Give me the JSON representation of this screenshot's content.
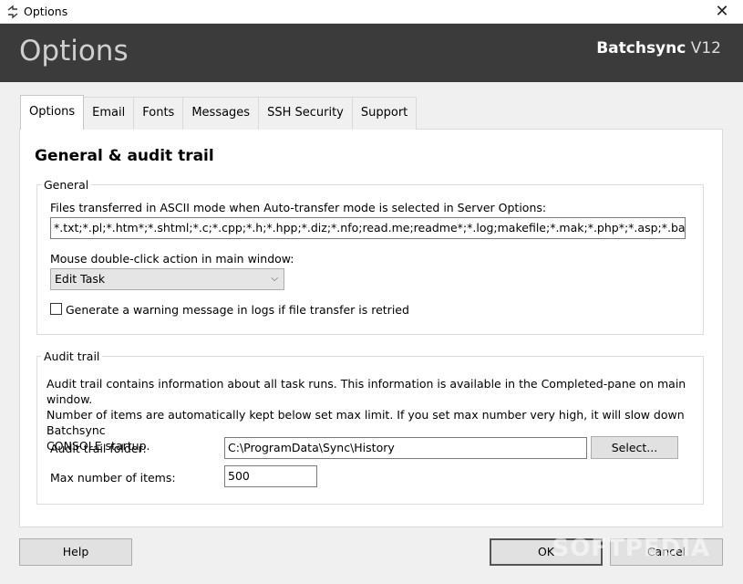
{
  "window": {
    "title": "Options",
    "close_glyph": "✕",
    "icon": "sync-app-icon"
  },
  "banner": {
    "title": "Options",
    "brand": "Batchsync",
    "version": "V12"
  },
  "tabs": [
    {
      "label": "Options"
    },
    {
      "label": "Email"
    },
    {
      "label": "Fonts"
    },
    {
      "label": "Messages"
    },
    {
      "label": "SSH Security"
    },
    {
      "label": "Support"
    }
  ],
  "section_title": "General & audit trail",
  "general": {
    "legend": "General",
    "ascii_label": "Files transferred in ASCII mode when Auto-transfer mode is selected in Server Options:",
    "ascii_value": "*.txt;*.pl;*.htm*;*.shtml;*.c;*.cpp;*.h;*.hpp;*.diz;*.nfo;read.me;readme*;*.log;makefile;*.mak;*.php*;*.asp;*.bat;*.cfm;*.cgi;*.css",
    "dblclick_label": "Mouse double-click action in main window:",
    "dblclick_value": "Edit Task",
    "warn_label": "Generate a warning message in logs if file transfer is retried",
    "warn_checked": false
  },
  "audit": {
    "legend": "Audit trail",
    "description_line1": "Audit trail contains information about all task runs. This information is available in the Completed-pane on main window.",
    "description_line2": "Number of items are automatically kept below set max limit. If you set max number very high, it will slow down Batchsync",
    "description_line3": "CONSOLE startup.",
    "folder_label": "Audit trail folder:",
    "folder_value": "C:\\ProgramData\\Sync\\History",
    "select_label": "Select...",
    "max_label": "Max number of items:",
    "max_value": "500"
  },
  "buttons": {
    "help": "Help",
    "ok": "OK",
    "cancel": "Cancel"
  },
  "watermark": "SOFTPEDIA"
}
